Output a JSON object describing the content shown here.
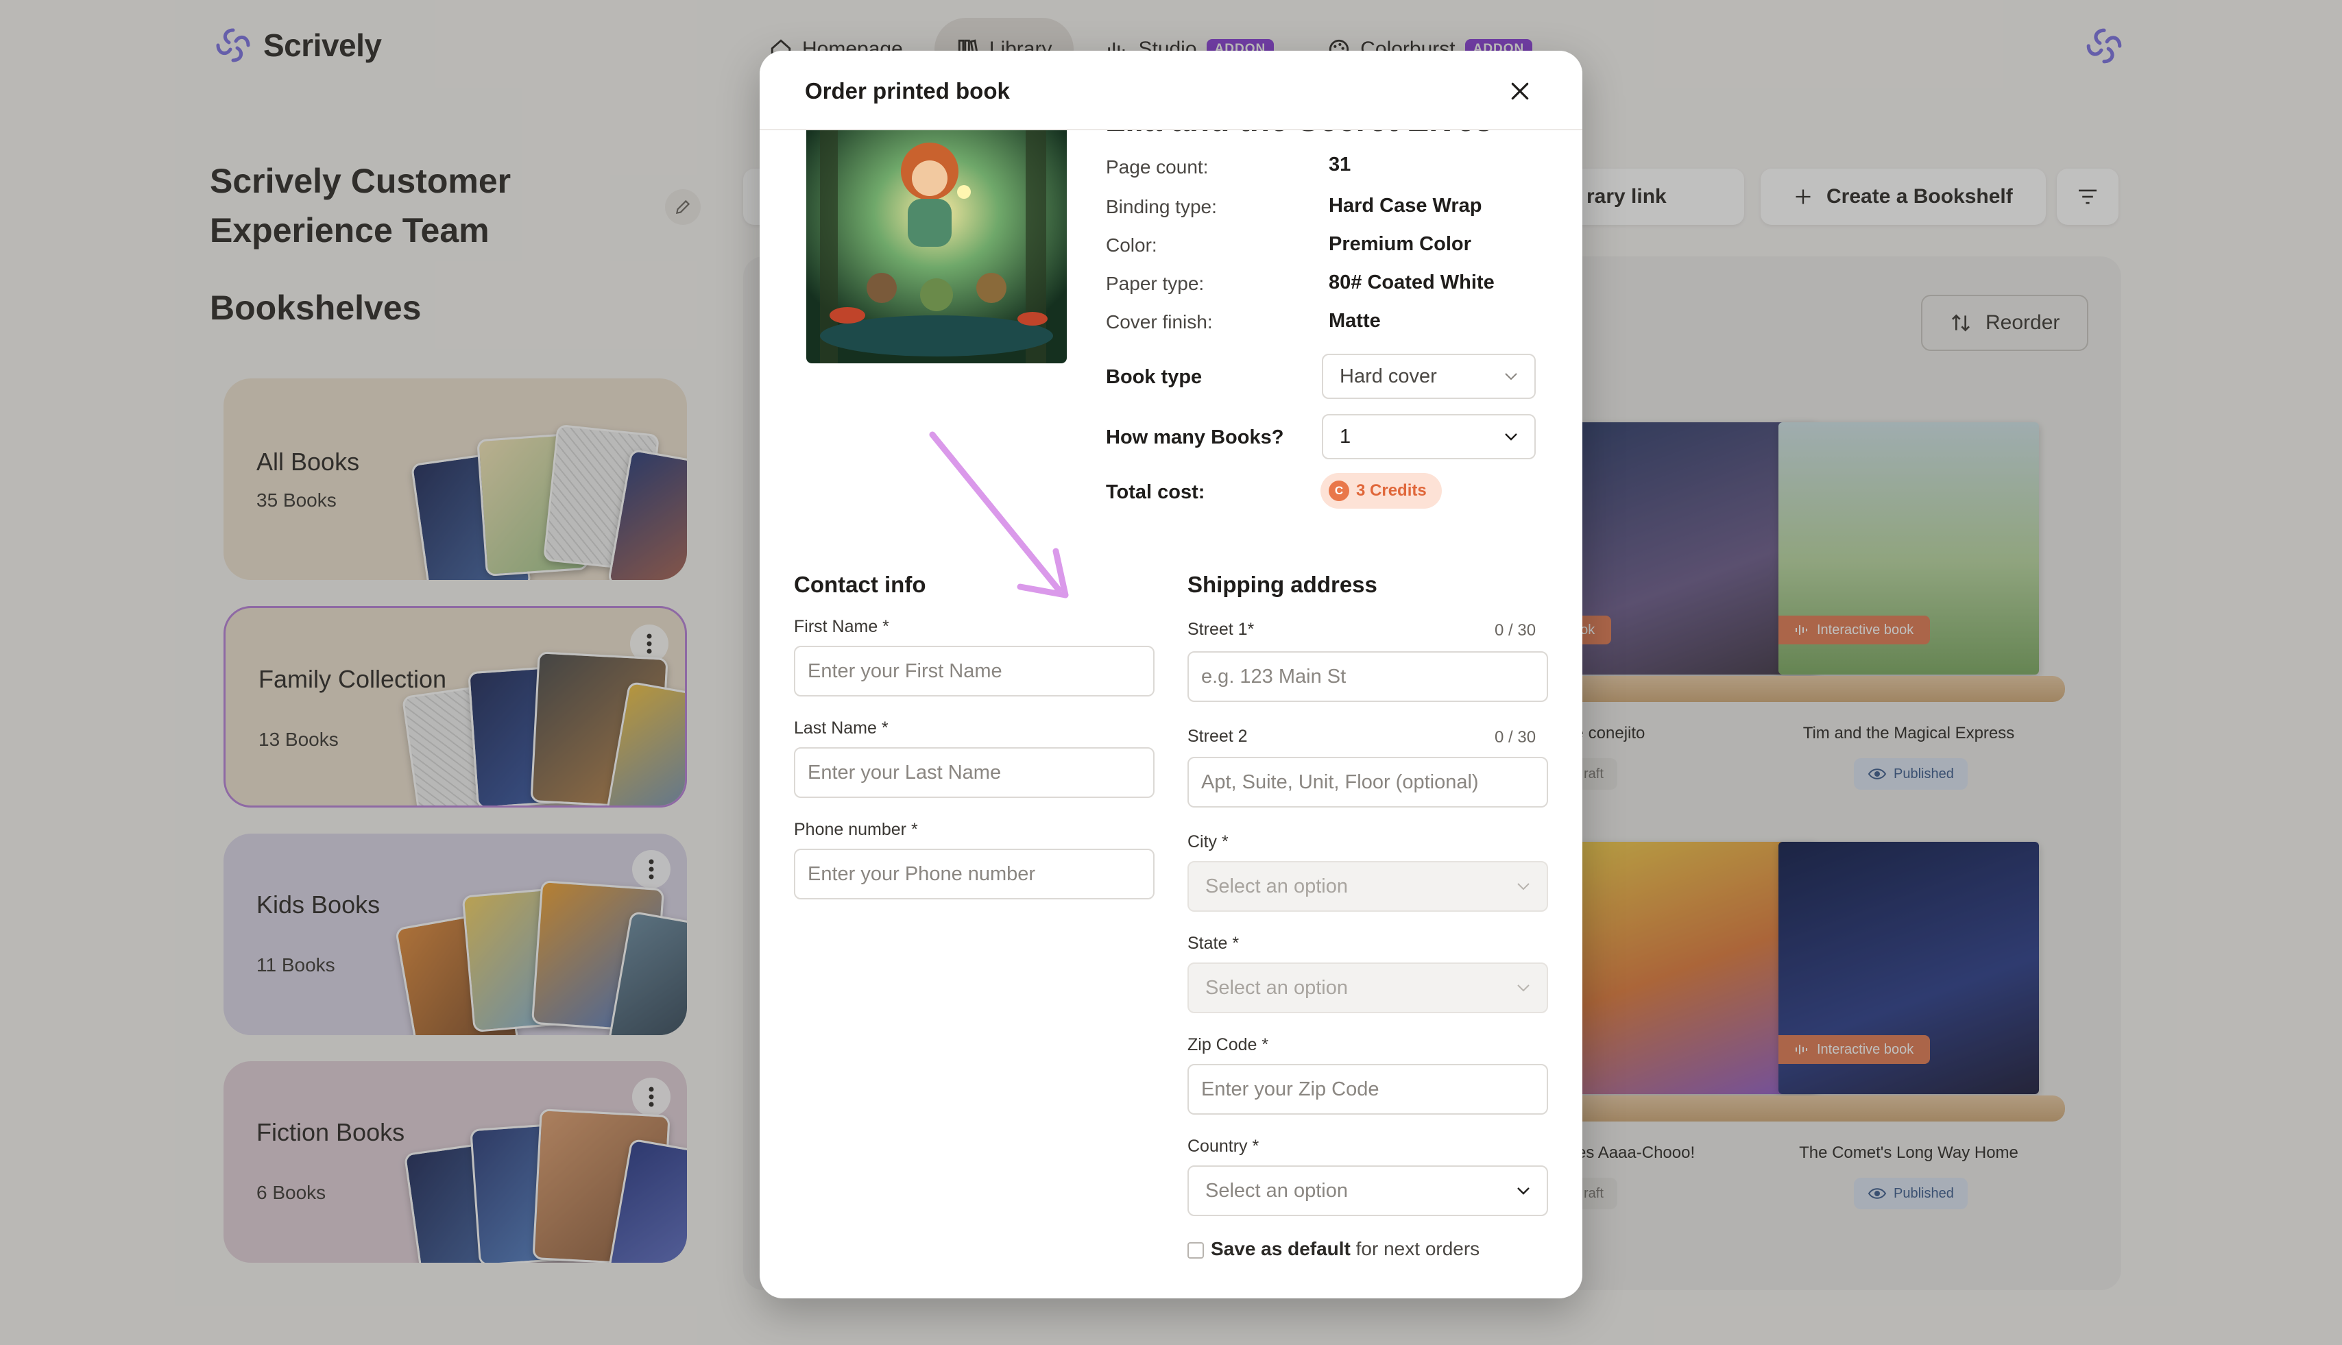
{
  "app": {
    "name": "Scrively"
  },
  "nav": {
    "items": [
      {
        "label": "Homepage"
      },
      {
        "label": "Library"
      },
      {
        "label": "Studio",
        "badge": "ADDON"
      },
      {
        "label": "Colorburst",
        "badge": "ADDON"
      }
    ]
  },
  "sidebar": {
    "team_title": "Scrively Customer Experience Team",
    "bookshelves_title": "Bookshelves",
    "shelves": [
      {
        "name": "All Books",
        "count": "35 Books"
      },
      {
        "name": "Family Collection",
        "count": "13 Books"
      },
      {
        "name": "Kids Books",
        "count": "11 Books"
      },
      {
        "name": "Fiction Books",
        "count": "6 Books"
      }
    ]
  },
  "toolbar": {
    "library_link_label": "rary link",
    "create_bookshelf_label": "Create a Bookshelf",
    "reorder_label": "Reorder"
  },
  "books": [
    {
      "title": "te conejito",
      "status": "raft",
      "tag": "ook"
    },
    {
      "title": "Tim and the Magical Express",
      "status": "Published",
      "tag": "Interactive book"
    },
    {
      "title": "es Aaaa-Chooo!",
      "status": "raft"
    },
    {
      "title": "The Comet's Long Way Home",
      "status": "Published",
      "tag": "Interactive book"
    }
  ],
  "modal": {
    "title": "Order printed book",
    "book_title_partial": "Lila and the Secret Elves",
    "specs": [
      {
        "label": "Page count:",
        "value": "31"
      },
      {
        "label": "Binding type:",
        "value": "Hard Case Wrap"
      },
      {
        "label": "Color:",
        "value": "Premium Color"
      },
      {
        "label": "Paper type:",
        "value": "80# Coated White"
      },
      {
        "label": "Cover finish:",
        "value": "Matte"
      }
    ],
    "book_type_label": "Book type",
    "book_type_value": "Hard cover",
    "quantity_label": "How many Books?",
    "quantity_value": "1",
    "total_cost_label": "Total cost:",
    "total_cost_value": "3 Credits",
    "contact": {
      "title": "Contact info",
      "first_name_label": "First Name *",
      "first_name_placeholder": "Enter your First Name",
      "last_name_label": "Last Name *",
      "last_name_placeholder": "Enter your Last Name",
      "phone_label": "Phone number *",
      "phone_placeholder": "Enter your Phone number"
    },
    "shipping": {
      "title": "Shipping address",
      "street1_label": "Street 1*",
      "street1_counter": "0 / 30",
      "street1_placeholder": "e.g. 123 Main St",
      "street2_label": "Street 2",
      "street2_counter": "0 / 30",
      "street2_placeholder": "Apt, Suite, Unit, Floor (optional)",
      "city_label": "City *",
      "city_placeholder": "Select an option",
      "state_label": "State *",
      "state_placeholder": "Select an option",
      "zip_label": "Zip Code *",
      "zip_placeholder": "Enter your Zip Code",
      "country_label": "Country *",
      "country_placeholder": "Select an option"
    },
    "save_default_bold": "Save as default",
    "save_default_rest": " for next orders"
  }
}
